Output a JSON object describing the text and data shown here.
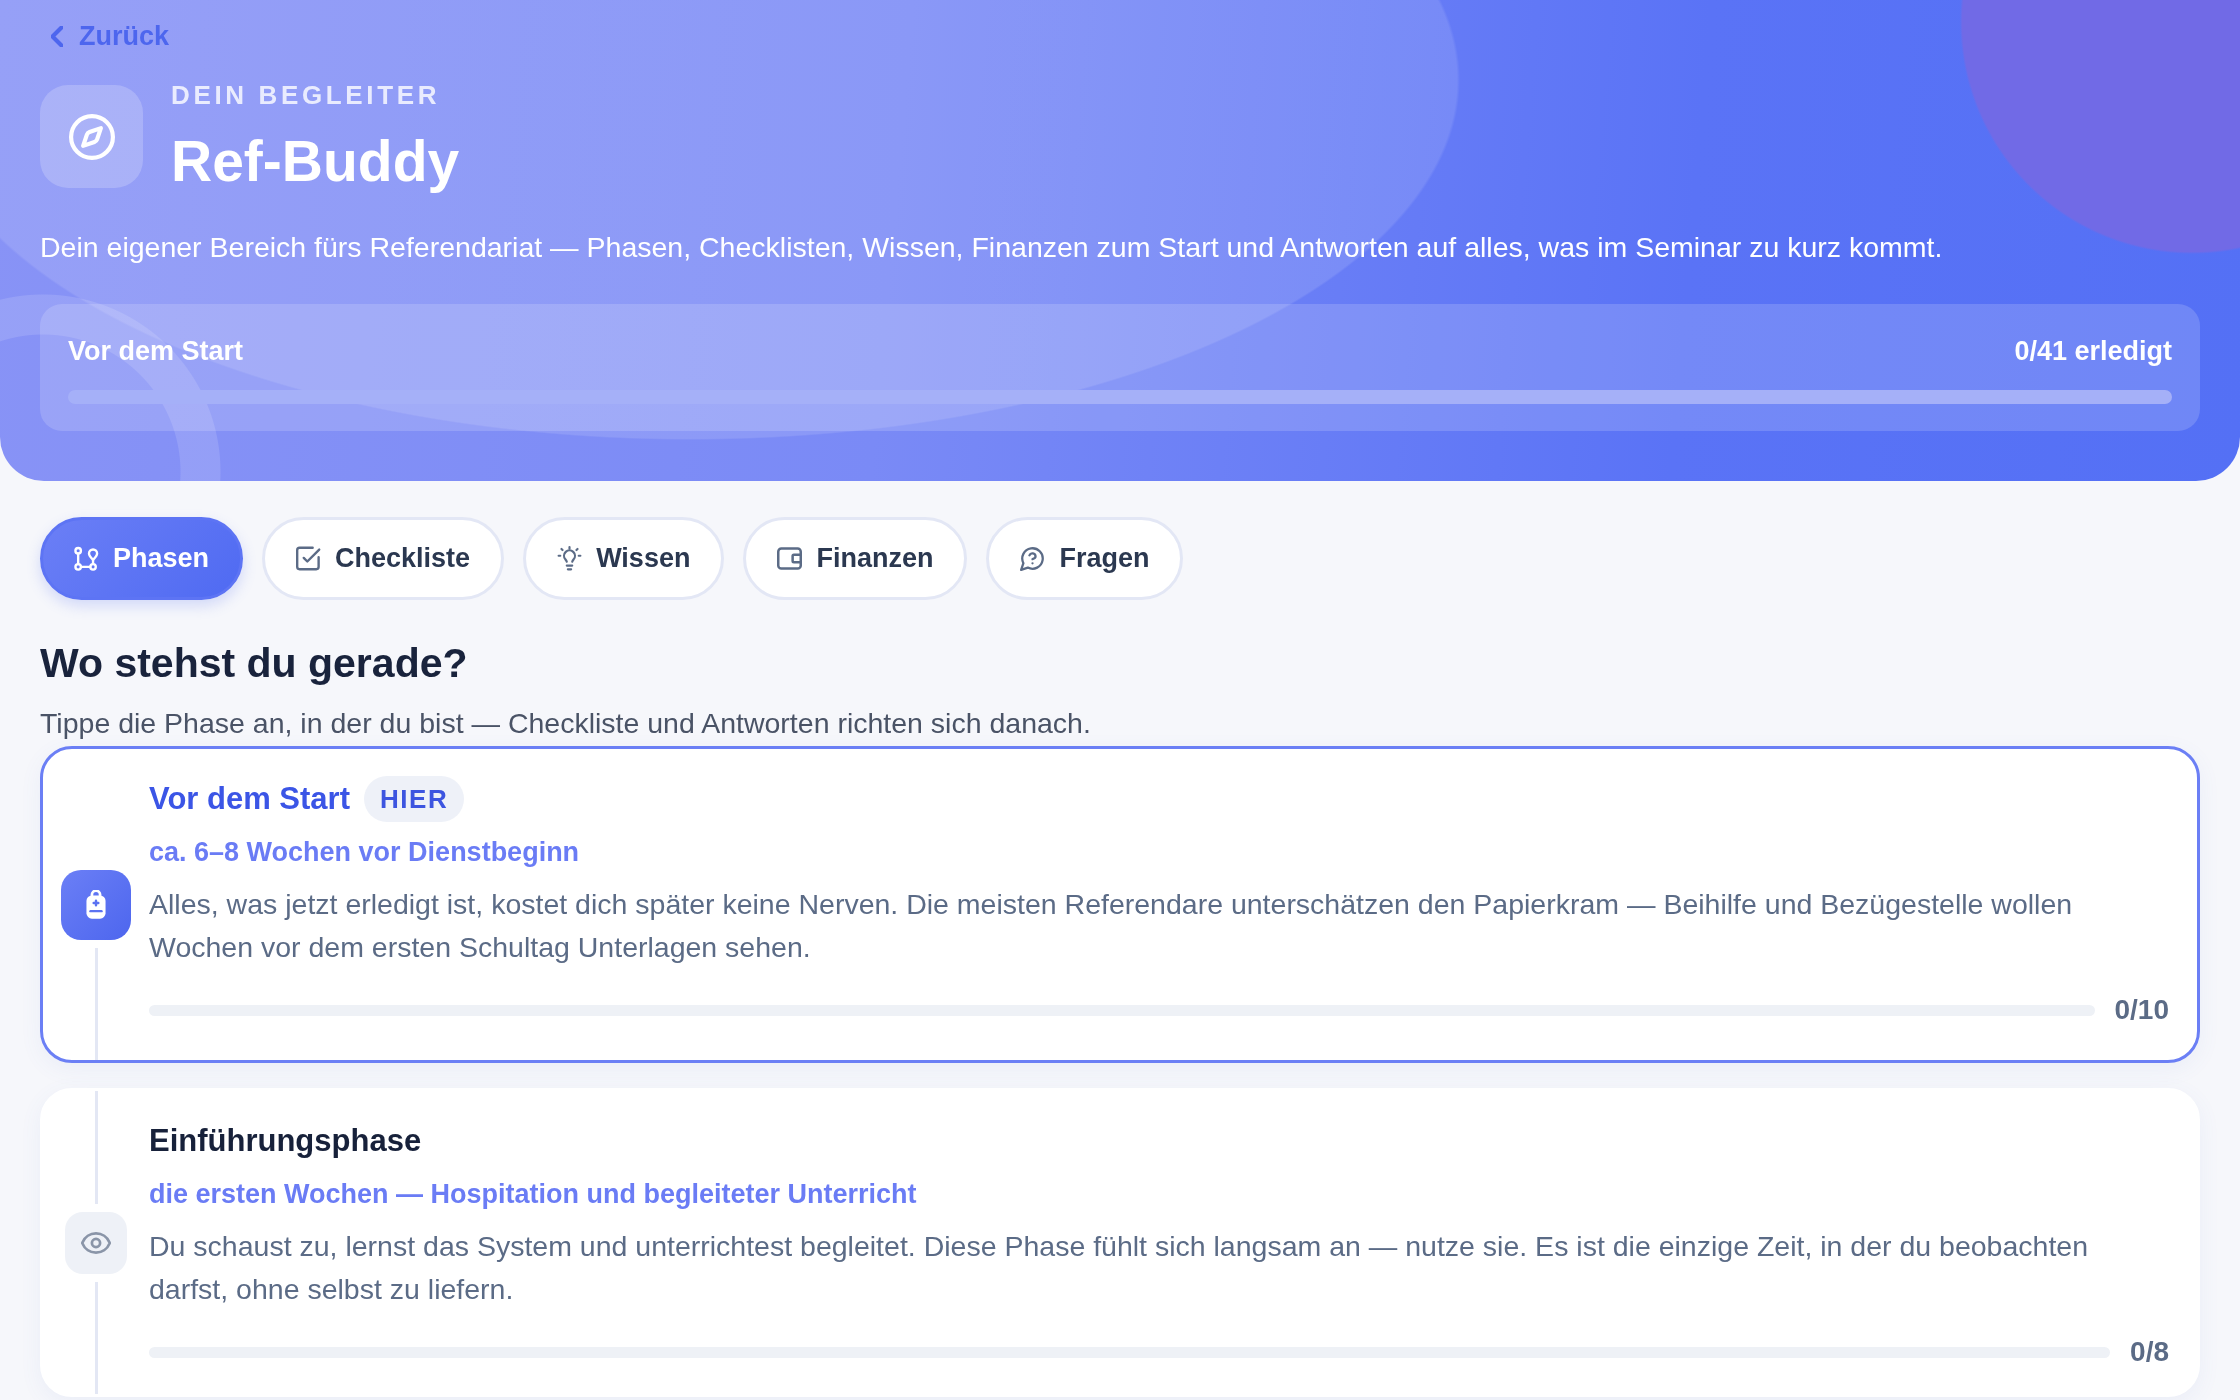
{
  "back_link": {
    "label": "Zurück"
  },
  "header": {
    "eyebrow": "DEIN BEGLEITER",
    "title": "Ref-Buddy",
    "description": "Dein eigener Bereich fürs Referendariat — Phasen, Checklisten, Wissen, Finanzen zum Start und Antworten auf alles, was im Seminar zu kurz kommt.",
    "progress": {
      "label": "Vor dem Start",
      "count": "0/41 erledigt"
    }
  },
  "tabs": [
    {
      "label": "Phasen",
      "selected": true
    },
    {
      "label": "Checkliste",
      "selected": false
    },
    {
      "label": "Wissen",
      "selected": false
    },
    {
      "label": "Finanzen",
      "selected": false
    },
    {
      "label": "Fragen",
      "selected": false
    }
  ],
  "phases": {
    "heading": "Wo stehst du gerade?",
    "hint": "Tippe die Phase an, in der du bist — Checkliste und Antworten richten sich danach.",
    "items": [
      {
        "title": "Vor dem Start",
        "badge": "HIER",
        "subtitle": "ca. 6–8 Wochen vor Dienstbeginn",
        "description": "Alles, was jetzt erledigt ist, kostet dich später keine Nerven. Die meisten Referendare unterschätzen den Papierkram — Beihilfe und Bezügestelle wollen Wochen vor dem ersten Schultag Unterlagen sehen.",
        "count": "0/10",
        "level": 0,
        "selected": true
      },
      {
        "title": "Einführungsphase",
        "subtitle": "die ersten Wochen — Hospitation und begleiteter Unterricht",
        "description": "Du schaust zu, lernst das System und unterrichtest begleitet. Diese Phase fühlt sich langsam an — nutze sie. Es ist die einzige Zeit, in der du beobachten darfst, ohne selbst zu liefern.",
        "count": "0/8",
        "level": 0,
        "selected": false
      }
    ]
  }
}
